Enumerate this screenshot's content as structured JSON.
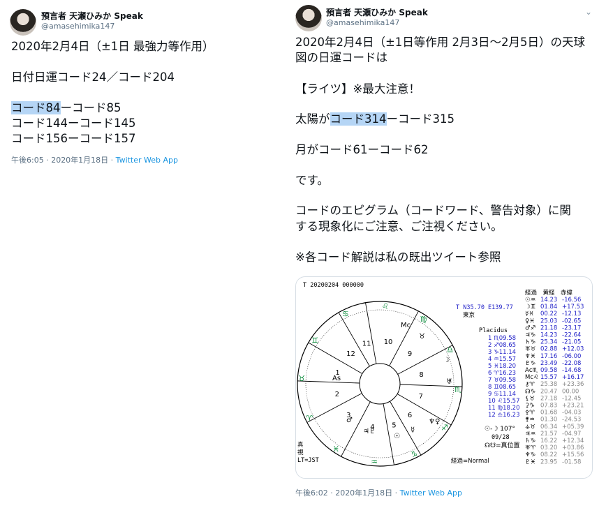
{
  "tweets": [
    {
      "user": {
        "name": "預言者 天瀬ひみか Speak",
        "handle": "@amasehimika147"
      },
      "lines": [
        "2020年2月4日（±1日 最強力等作用）",
        "日付日運コード24／コード204",
        "",
        "コード84",
        "ーコード85",
        "コード144ーコード145",
        "コード156ーコード157"
      ],
      "meta": {
        "time": "午後6:05 · 2020年1月18日 · ",
        "app": "Twitter Web App"
      }
    },
    {
      "user": {
        "name": "預言者 天瀬ひみか Speak",
        "handle": "@amasehimika147"
      },
      "chevron": "⌄",
      "lines": [
        "2020年2月4日（±1日等作用 2月3日〜2月5日）の天球",
        "図の日運コードは",
        "【ライツ】※最大注意！",
        "太陽が",
        "コード314",
        "ーコード315",
        "月がコード61ーコード62",
        "です。",
        "コードのエピグラム（コードワード、警告対象）に関",
        "する現象化にご注意、ご注視ください。",
        "※各コード解説は私の既出ツイート参照"
      ],
      "meta": {
        "time": "午後6:02 · 2020年1月18日 · ",
        "app": "Twitter Web App"
      }
    }
  ],
  "chart": {
    "title": "T 20200204 000000",
    "location": [
      "T N35.70 E139.77",
      "東京"
    ],
    "house_system": "Placidus",
    "house_numbers": [
      "10",
      "9",
      "8",
      "7",
      "6",
      "5",
      "4",
      "3",
      "2",
      "1",
      "12",
      "11"
    ],
    "houses": [
      "1 ♏09.58",
      "2 ♐08.65",
      "3 ♑11.14",
      "4 ♒15.57",
      "5 ♓18.20",
      "6 ♈16.23",
      "7 ♉09.58",
      "8 ♊08.65",
      "9 ♋11.14",
      "10 ♌15.57",
      "11 ♍18.20",
      "12 ♎16.23"
    ],
    "table_header": "経過　黄経　赤緯",
    "planets": [
      {
        "g": "☉♒",
        "lon": "14.23",
        "dec": "-16.56"
      },
      {
        "g": "☽♊",
        "lon": "01.84",
        "dec": "+17.53"
      },
      {
        "g": "☿♓",
        "lon": "00.22",
        "dec": "-12.13"
      },
      {
        "g": "♀♓",
        "lon": "25.03",
        "dec": "-02.65"
      },
      {
        "g": "♂♐",
        "lon": "21.18",
        "dec": "-23.17"
      },
      {
        "g": "♃♑",
        "lon": "14.23",
        "dec": "-22.64"
      },
      {
        "g": "♄♑",
        "lon": "25.34",
        "dec": "-21.05"
      },
      {
        "g": "♅♉",
        "lon": "02.88",
        "dec": "+12.03"
      },
      {
        "g": "♆♓",
        "lon": "17.16",
        "dec": "-06.00"
      },
      {
        "g": "♇♑",
        "lon": "23.49",
        "dec": "-22.08"
      },
      {
        "g": "Aс♏",
        "lon": "09.58",
        "dec": "-14.68"
      },
      {
        "g": "Mс♌",
        "lon": "15.57",
        "dec": "+16.17"
      },
      {
        "g": "⚷♈",
        "lon": "25.38",
        "dec": "+23.36"
      },
      {
        "g": "☊♑",
        "lon": "20.47",
        "dec": "00.00"
      },
      {
        "g": "⚸♉",
        "lon": "27.18",
        "dec": "-12.45"
      },
      {
        "g": "⚳♑",
        "lon": "07.83",
        "dec": "+23.21"
      },
      {
        "g": "⚴♈",
        "lon": "01.68",
        "dec": "-04.03"
      },
      {
        "g": "⚵♒",
        "lon": "01.30",
        "dec": "-24.53"
      },
      {
        "g": "⚶♉",
        "lon": "06.34",
        "dec": "+05.39"
      },
      {
        "g": "♃♒",
        "lon": "21.57",
        "dec": "-04.97"
      },
      {
        "g": "♄♑",
        "lon": "16.22",
        "dec": "+12.34"
      },
      {
        "g": "♅♈",
        "lon": "03.20",
        "dec": "+03.86"
      },
      {
        "g": "♆♑",
        "lon": "08.22",
        "dec": "+15.56"
      },
      {
        "g": "♇♓",
        "lon": "23.95",
        "dec": "-01.58"
      }
    ],
    "aspect_line": "☉-☽  107°",
    "date_small": "09/28",
    "node_note": "☊☋=真位置",
    "true_label": [
      "真",
      "視"
    ],
    "tz": "LT=JST",
    "footer": "経過=Normal",
    "colors": {
      "blue": "#2323c8",
      "green": "#0a8a3a",
      "gray": "#888888",
      "ink": "#000000"
    }
  }
}
